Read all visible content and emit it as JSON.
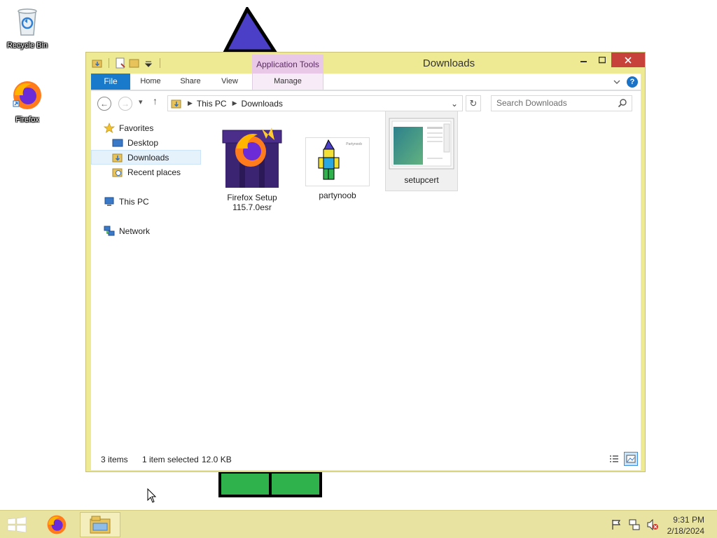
{
  "desktop": {
    "icons": [
      {
        "label": "Recycle Bin"
      },
      {
        "label": "Firefox"
      }
    ]
  },
  "window": {
    "title": "Downloads",
    "contextual_group": "Application Tools",
    "tabs": {
      "file": "File",
      "home": "Home",
      "share": "Share",
      "view": "View",
      "manage": "Manage"
    },
    "help_label": "?"
  },
  "address": {
    "crumbs": [
      "This PC",
      "Downloads"
    ],
    "search_placeholder": "Search Downloads"
  },
  "nav": {
    "favorites": "Favorites",
    "desktop": "Desktop",
    "downloads": "Downloads",
    "recent": "Recent places",
    "thispc": "This PC",
    "network": "Network"
  },
  "files": [
    {
      "name_line1": "Firefox Setup",
      "name_line2": "115.7.0esr",
      "selected": false
    },
    {
      "name_line1": "partynoob",
      "name_line2": "",
      "selected": false
    },
    {
      "name_line1": "setupcert",
      "name_line2": "",
      "selected": true
    }
  ],
  "partynoob_thumb_text": "Partynoob",
  "status": {
    "items": "3 items",
    "selected": "1 item selected",
    "size": "12.0 KB"
  },
  "clock": {
    "time": "9:31 PM",
    "date": "2/18/2024"
  },
  "colors": {
    "window_frame": "#eee993",
    "taskbar": "#e8e3a0",
    "file_tab": "#1979ca",
    "close_button": "#c7423a",
    "app_tools": "#e9c8e7"
  }
}
